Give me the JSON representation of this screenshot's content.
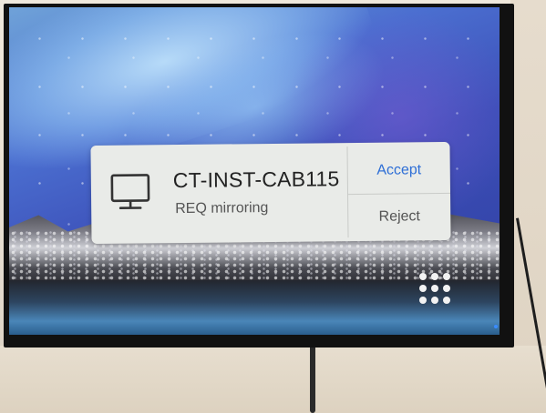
{
  "dialog": {
    "icon": "monitor-icon",
    "device_name": "CT-INST-CAB115",
    "request_text": "REQ mirroring",
    "accept_label": "Accept",
    "reject_label": "Reject"
  },
  "launcher": {
    "icon": "app-grid-icon"
  },
  "colors": {
    "accent": "#2f6fd6",
    "dialog_bg": "#e9ebe8",
    "text_primary": "#222222",
    "text_secondary": "#555555"
  }
}
